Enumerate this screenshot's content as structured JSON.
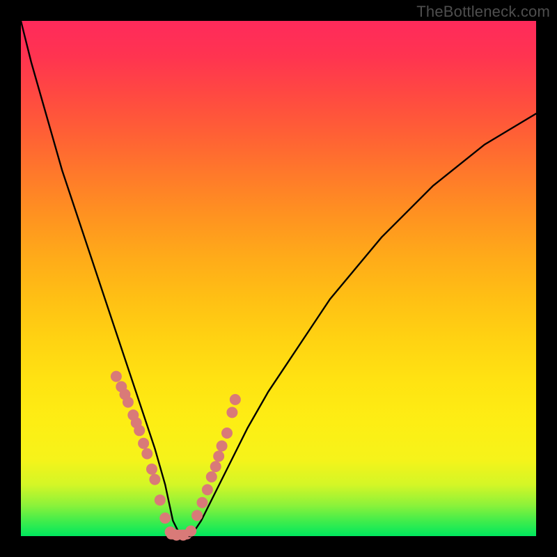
{
  "watermark": "TheBottleneck.com",
  "chart_data": {
    "type": "line",
    "title": "",
    "xlabel": "",
    "ylabel": "",
    "xlim": [
      0,
      100
    ],
    "ylim": [
      0,
      100
    ],
    "grid": false,
    "legend": false,
    "curve": {
      "x": [
        0,
        2,
        4,
        6,
        8,
        10,
        12,
        14,
        16,
        18,
        20,
        22,
        24,
        26,
        28,
        29.5,
        31,
        33,
        35,
        38,
        41,
        44,
        48,
        52,
        56,
        60,
        65,
        70,
        75,
        80,
        85,
        90,
        95,
        100
      ],
      "y": [
        100,
        92,
        85,
        78,
        71,
        65,
        59,
        53,
        47,
        41,
        35,
        29,
        23,
        17,
        10,
        3,
        0,
        0,
        3,
        9,
        15,
        21,
        28,
        34,
        40,
        46,
        52,
        58,
        63,
        68,
        72,
        76,
        79,
        82
      ]
    },
    "markers": {
      "x": [
        18.5,
        19.5,
        20.2,
        20.8,
        21.8,
        22.4,
        23.0,
        23.8,
        24.5,
        25.4,
        26.0,
        27.0,
        28.0,
        29.0,
        30.2,
        31.5,
        33.0,
        34.2,
        35.2,
        36.2,
        37.0,
        37.8,
        38.4,
        39.0,
        40.0,
        41.0,
        41.6
      ],
      "y": [
        31.0,
        29.0,
        27.5,
        26.0,
        23.5,
        22.0,
        20.5,
        18.0,
        16.0,
        13.0,
        11.0,
        7.0,
        3.5,
        0.8,
        0.2,
        0.2,
        1.0,
        4.0,
        6.5,
        9.0,
        11.5,
        13.5,
        15.5,
        17.5,
        20.0,
        24.0,
        26.5
      ],
      "color": "#d97a78",
      "radius": 8
    },
    "plateau": {
      "x_range": [
        28.2,
        33.2
      ],
      "y": 0.3,
      "color": "#d97a78"
    }
  }
}
